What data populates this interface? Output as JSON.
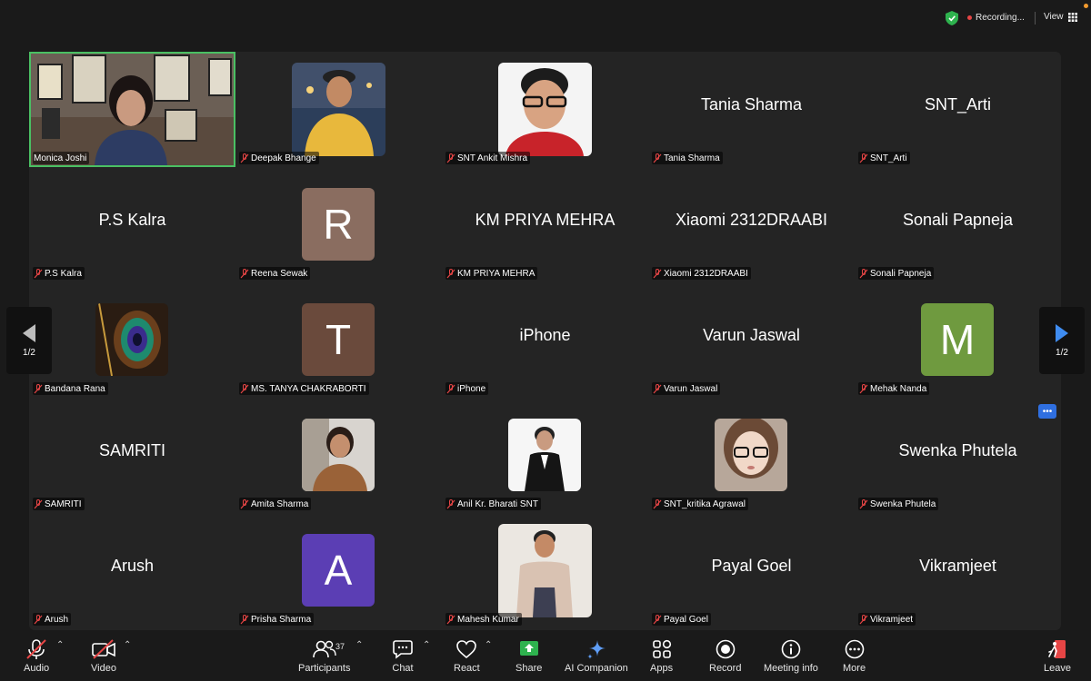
{
  "top_bar": {
    "recording_label": "Recording...",
    "view_label": "View"
  },
  "tiles": [
    {
      "name": "Monica Joshi",
      "type": "video"
    },
    {
      "name": "Deepak Bhange",
      "type": "photo"
    },
    {
      "name": "SNT Ankit Mishra",
      "type": "photo"
    },
    {
      "name": "Tania Sharma",
      "type": "name",
      "display": "Tania Sharma"
    },
    {
      "name": "SNT_Arti",
      "type": "name",
      "display": "SNT_Arti"
    },
    {
      "name": "P.S Kalra",
      "type": "name",
      "display": "P.S Kalra"
    },
    {
      "name": "Reena Sewak",
      "type": "letter",
      "letter": "R",
      "color": "#8a6d60"
    },
    {
      "name": "KM PRIYA MEHRA",
      "type": "name",
      "display": "KM PRIYA MEHRA"
    },
    {
      "name": "Xiaomi 2312DRAABI",
      "type": "name",
      "display": "Xiaomi 2312DRAABI"
    },
    {
      "name": "Sonali Papneja",
      "type": "name",
      "display": "Sonali Papneja"
    },
    {
      "name": "Bandana Rana",
      "type": "photo"
    },
    {
      "name": "MS. TANYA CHAKRABORTI",
      "type": "letter",
      "letter": "T",
      "color": "#6a4a3c"
    },
    {
      "name": "iPhone",
      "type": "name",
      "display": "iPhone"
    },
    {
      "name": "Varun Jaswal",
      "type": "name",
      "display": "Varun Jaswal"
    },
    {
      "name": "Mehak Nanda",
      "type": "letter",
      "letter": "M",
      "color": "#6f9a3f"
    },
    {
      "name": "SAMRITI",
      "type": "name",
      "display": "SAMRITI"
    },
    {
      "name": "Amita Sharma",
      "type": "photo"
    },
    {
      "name": "Anil Kr. Bharati SNT",
      "type": "photo"
    },
    {
      "name": "SNT_kritika Agrawal",
      "type": "photo"
    },
    {
      "name": "Swenka Phutela",
      "type": "name",
      "display": "Swenka Phutela"
    },
    {
      "name": "Arush",
      "type": "name",
      "display": "Arush"
    },
    {
      "name": "Prisha Sharma",
      "type": "letter",
      "letter": "A",
      "color": "#5b3eb4"
    },
    {
      "name": "Mahesh Kumar",
      "type": "photo"
    },
    {
      "name": "Payal Goel",
      "type": "name",
      "display": "Payal Goel"
    },
    {
      "name": "Vikramjeet",
      "type": "name",
      "display": "Vikramjeet"
    }
  ],
  "pagination": {
    "left": "1/2",
    "right": "1/2"
  },
  "toolbar": {
    "audio": "Audio",
    "video": "Video",
    "participants": "Participants",
    "participants_count": "37",
    "chat": "Chat",
    "react": "React",
    "share": "Share",
    "ai_companion": "AI Companion",
    "apps": "Apps",
    "record": "Record",
    "meeting_info": "Meeting info",
    "more": "More",
    "leave": "Leave"
  },
  "colors": {
    "active_speaker": "#4ac063",
    "share_green": "#2eb24e",
    "leave_red": "#e64545",
    "accent_blue": "#2f6fe0"
  }
}
